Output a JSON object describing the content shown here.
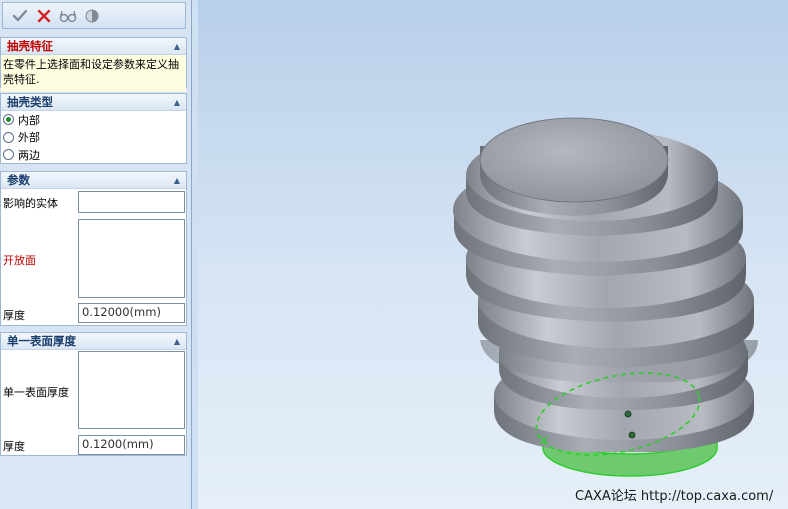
{
  "toolbar": {
    "ok_icon": "checkmark-icon",
    "cancel_icon": "cross-icon",
    "preview_icon": "glasses-icon",
    "shade_icon": "half-sphere-icon"
  },
  "shell_feature": {
    "title": "抽壳特征",
    "description": "在零件上选择面和设定参数来定义抽壳特征."
  },
  "shell_type": {
    "title": "抽壳类型",
    "options": [
      {
        "label": "内部",
        "selected": true
      },
      {
        "label": "外部",
        "selected": false
      },
      {
        "label": "两边",
        "selected": false
      }
    ]
  },
  "parameters": {
    "title": "参数",
    "affected_body_label": "影响的实体",
    "affected_body_value": "",
    "open_face_label": "开放面",
    "thickness_label": "厚度",
    "thickness_value": "0.12000(mm)"
  },
  "single_surface": {
    "title": "单一表面厚度",
    "surface_label": "单一表面厚度",
    "thickness_label": "厚度",
    "thickness_value": "0.1200(mm)"
  },
  "watermark": "CAXA论坛 http://top.caxa.com/",
  "colors": {
    "panel_bg": "#d6e4f3",
    "header_red": "#c00000",
    "selection_green": "#2ecc2e"
  }
}
